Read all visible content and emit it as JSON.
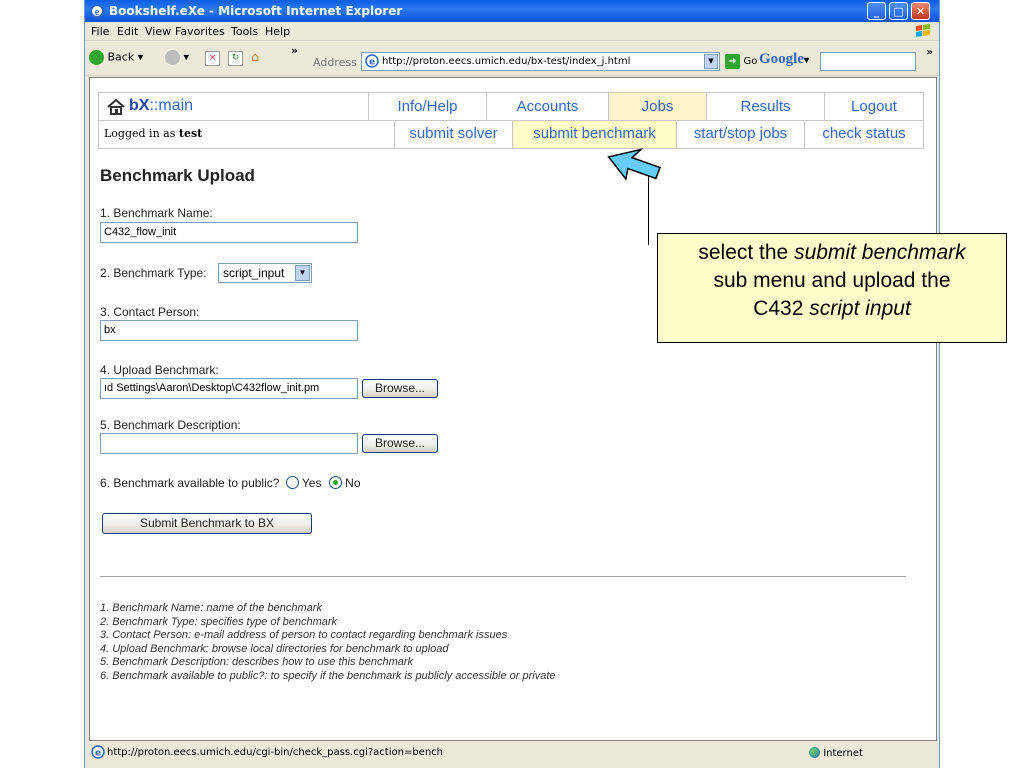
{
  "window": {
    "title": "Bookshelf.eXe - Microsoft Internet Explorer",
    "controls": [
      "_",
      "□",
      "✕"
    ]
  },
  "menubar": [
    "File",
    "Edit",
    "View",
    "Favorites",
    "Tools",
    "Help"
  ],
  "toolbar": {
    "back_label": "Back",
    "address_label": "Address",
    "url": "http://proton.eecs.umich.edu/bx-test/index_j.html",
    "go_label": "Go",
    "google_label": "Google",
    "overflow": "»"
  },
  "site_nav": {
    "brand_bold": "bX",
    "brand_rest": "::main",
    "top_items": [
      "Info/Help",
      "Accounts",
      "Jobs",
      "Results",
      "Logout"
    ],
    "sub_items": [
      "submit solver",
      "submit benchmark",
      "start/stop jobs",
      "check status"
    ],
    "logged_in_prefix": "Logged in as",
    "logged_in_user": "test",
    "active_top": "Jobs",
    "active_sub": "submit benchmark"
  },
  "form": {
    "title": "Benchmark Upload",
    "name_label": "1. Benchmark Name:",
    "name_value": "C432_flow_init",
    "type_label": "2. Benchmark Type:",
    "type_value": "script_input",
    "contact_label": "3. Contact Person:",
    "contact_value": "bx",
    "upload_label": "4. Upload Benchmark:",
    "upload_value": "ıd Settings\\Aaron\\Desktop\\C432flow_init.pm",
    "browse_label": "Browse...",
    "description_label": "5. Benchmark Description:",
    "description_value": "",
    "public_label": "6. Benchmark available to public?",
    "public_yes": "Yes",
    "public_no": "No",
    "public_selected": "No",
    "submit_label": "Submit Benchmark to BX"
  },
  "notes": [
    "1. Benchmark Name: name of the benchmark",
    "2. Benchmark Type: specifies type of benchmark",
    "3. Contact Person: e-mail address of person to contact regarding benchmark issues",
    "4. Upload Benchmark: browse local directories for benchmark to upload",
    "5. Benchmark Description: describes how to use this benchmark",
    "6. Benchmark available to public?: to specify if the benchmark is publicly accessible or private"
  ],
  "statusbar": {
    "url": "http://proton.eecs.umich.edu/cgi-bin/check_pass.cgi?action=bench",
    "zone": "Internet"
  },
  "callout": {
    "line1_plain": "select the ",
    "line1_italic": "submit benchmark",
    "line2": "sub menu and upload the",
    "line3_plain": "C432 ",
    "line3_italic": "script input"
  },
  "colors": {
    "link": "#3366cc",
    "selected_bg": "#ffffcc",
    "callout_bg": "#ffffcc",
    "arrow": "#66ccff"
  }
}
